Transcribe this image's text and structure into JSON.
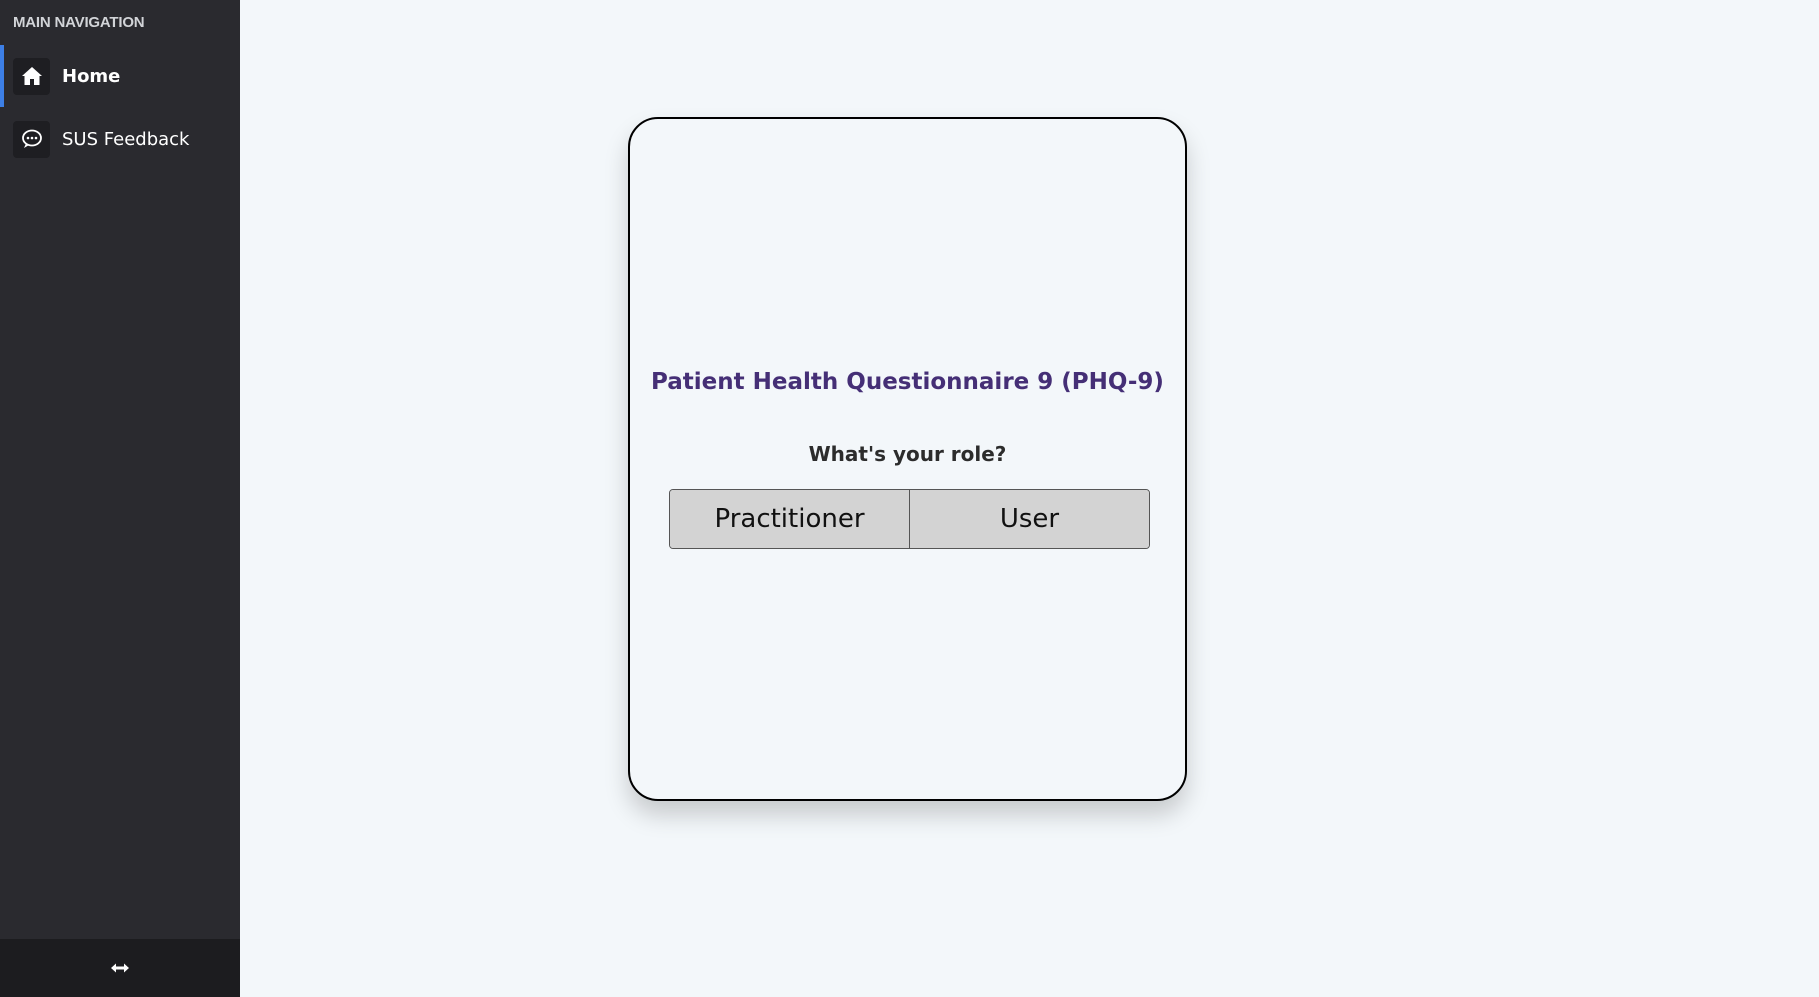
{
  "sidebar": {
    "heading": "MAIN NAVIGATION",
    "items": [
      {
        "label": "Home",
        "icon": "home-icon",
        "active": true
      },
      {
        "label": "SUS Feedback",
        "icon": "chat-icon",
        "active": false
      }
    ],
    "footer_icon": "resize-horizontal-icon"
  },
  "card": {
    "title": "Patient Health Questionnaire 9 (PHQ-9)",
    "question": "What's your role?",
    "roles": [
      "Practitioner",
      "User"
    ]
  },
  "colors": {
    "sidebar_bg": "#2a2a2f",
    "active_accent": "#3d7fe6",
    "title_color": "#452f76",
    "page_bg": "#f3f7fa",
    "button_bg": "#d3d3d3"
  }
}
